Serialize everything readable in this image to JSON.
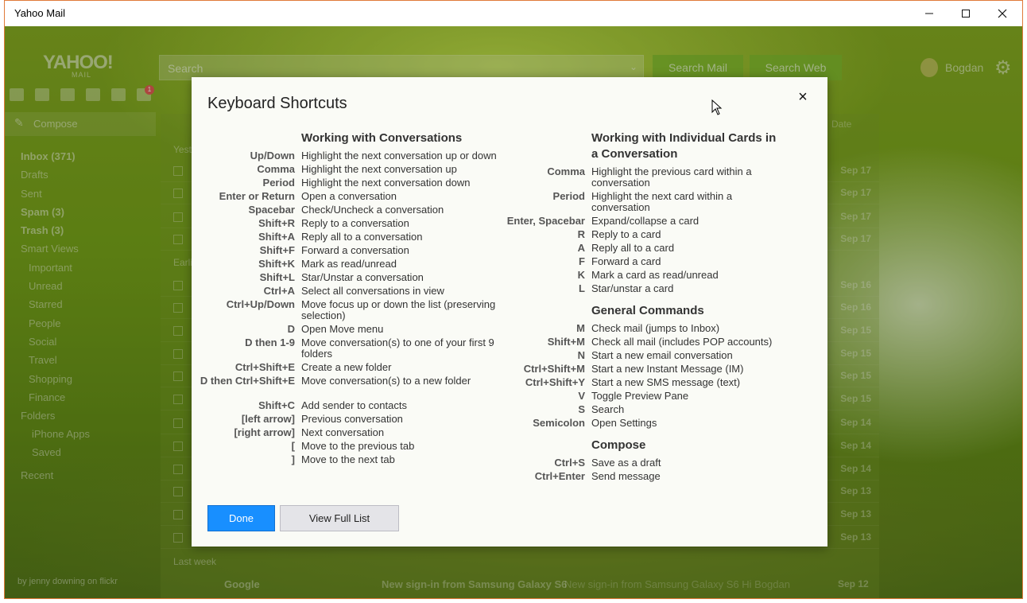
{
  "window": {
    "title": "Yahoo Mail"
  },
  "header": {
    "logo": "YAHOO!",
    "logo_sub": "MAIL",
    "search_placeholder": "Search",
    "search_mail": "Search Mail",
    "search_web": "Search Web",
    "user": "Bogdan"
  },
  "sidebar": {
    "compose": "Compose",
    "items": [
      {
        "label": "Inbox (371)",
        "bold": true
      },
      {
        "label": "Drafts"
      },
      {
        "label": "Sent"
      },
      {
        "label": "Spam (3)",
        "bold": true
      },
      {
        "label": "Trash (3)",
        "bold": true
      },
      {
        "label": "Smart Views"
      },
      {
        "label": "Important"
      },
      {
        "label": "Unread"
      },
      {
        "label": "Starred"
      },
      {
        "label": "People"
      },
      {
        "label": "Social"
      },
      {
        "label": "Travel"
      },
      {
        "label": "Shopping"
      },
      {
        "label": "Finance"
      },
      {
        "label": "Folders"
      },
      {
        "label": "iPhone Apps"
      },
      {
        "label": "Saved"
      },
      {
        "label": "Recent"
      }
    ],
    "credit": "by jenny downing on flickr"
  },
  "list": {
    "date_sort": "Date",
    "section_yesterday": "Yeste",
    "section_earlier": "Earlie",
    "section_lastweek": "Last week",
    "dates": [
      "Sep 17",
      "Sep 17",
      "Sep 17",
      "Sep 17",
      "Sep 16",
      "Sep 16",
      "Sep 15",
      "Sep 15",
      "Sep 15",
      "Sep 15",
      "Sep 14",
      "Sep 14",
      "Sep 14",
      "Sep 13",
      "Sep 13",
      "Sep 13"
    ],
    "last_sender": "Google",
    "last_subject": "New sign-in from Samsung Galaxy S6",
    "last_preview": "New sign-in from Samsung Galaxy S6 Hi Bogdan",
    "last_date": "Sep 12"
  },
  "dialog": {
    "title": "Keyboard Shortcuts",
    "close_icon": "×",
    "done": "Done",
    "view_full": "View Full List",
    "conversations": {
      "title": "Working with Conversations",
      "items": [
        {
          "key": "Up/Down",
          "desc": "Highlight the next conversation up or down"
        },
        {
          "key": "Comma",
          "desc": "Highlight the next conversation up"
        },
        {
          "key": "Period",
          "desc": "Highlight the next conversation down"
        },
        {
          "key": "Enter or Return",
          "desc": "Open a conversation"
        },
        {
          "key": "Spacebar",
          "desc": "Check/Uncheck a conversation"
        },
        {
          "key": "Shift+R",
          "desc": "Reply to a conversation"
        },
        {
          "key": "Shift+A",
          "desc": "Reply all to a conversation"
        },
        {
          "key": "Shift+F",
          "desc": "Forward a conversation"
        },
        {
          "key": "Shift+K",
          "desc": "Mark as read/unread"
        },
        {
          "key": "Shift+L",
          "desc": "Star/Unstar a conversation"
        },
        {
          "key": "Ctrl+A",
          "desc": "Select all conversations in view"
        },
        {
          "key": "Ctrl+Up/Down",
          "desc": "Move focus up or down the list (preserving selection)"
        },
        {
          "key": "D",
          "desc": "Open Move menu"
        },
        {
          "key": "D then 1-9",
          "desc": "Move conversation(s) to one of your first 9 folders"
        },
        {
          "key": "Ctrl+Shift+E",
          "desc": "Create a new folder"
        },
        {
          "key": "D then Ctrl+Shift+E",
          "desc": "Move conversation(s) to a new folder"
        },
        {
          "key": "Shift+C",
          "desc": "Add sender to contacts"
        },
        {
          "key": "[left arrow]",
          "desc": "Previous conversation"
        },
        {
          "key": "[right arrow]",
          "desc": "Next conversation"
        },
        {
          "key": "[",
          "desc": "Move to the previous tab"
        },
        {
          "key": "]",
          "desc": "Move to the next tab"
        }
      ]
    },
    "cards": {
      "title": "Working with Individual Cards in a Conversation",
      "items": [
        {
          "key": "Comma",
          "desc": "Highlight the previous card within a conversation"
        },
        {
          "key": "Period",
          "desc": "Highlight the next card within a conversation"
        },
        {
          "key": "Enter, Spacebar",
          "desc": "Expand/collapse a card"
        },
        {
          "key": "R",
          "desc": "Reply to a card"
        },
        {
          "key": "A",
          "desc": "Reply all to a card"
        },
        {
          "key": "F",
          "desc": "Forward a card"
        },
        {
          "key": "K",
          "desc": "Mark a card as read/unread"
        },
        {
          "key": "L",
          "desc": "Star/unstar a card"
        }
      ]
    },
    "general": {
      "title": "General Commands",
      "items": [
        {
          "key": "M",
          "desc": "Check mail (jumps to Inbox)"
        },
        {
          "key": "Shift+M",
          "desc": "Check all mail (includes POP accounts)"
        },
        {
          "key": "N",
          "desc": "Start a new email conversation"
        },
        {
          "key": "Ctrl+Shift+M",
          "desc": "Start a new Instant Message (IM)"
        },
        {
          "key": "Ctrl+Shift+Y",
          "desc": "Start a new SMS message (text)"
        },
        {
          "key": "V",
          "desc": "Toggle Preview Pane"
        },
        {
          "key": "S",
          "desc": "Search"
        },
        {
          "key": "Semicolon",
          "desc": "Open Settings"
        }
      ]
    },
    "compose": {
      "title": "Compose",
      "items": [
        {
          "key": "Ctrl+S",
          "desc": "Save as a draft"
        },
        {
          "key": "Ctrl+Enter",
          "desc": "Send message"
        }
      ]
    }
  }
}
